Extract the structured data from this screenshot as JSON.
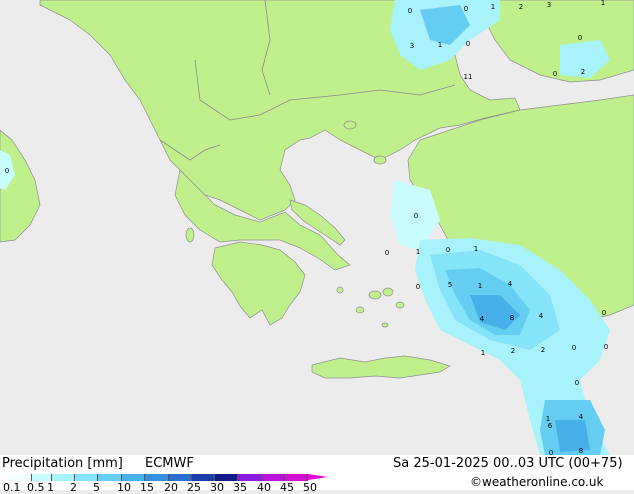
{
  "title": "Precipitation [mm]",
  "model": "ECMWF",
  "valid_time": "Sa 25-01-2025 00..03 UTC (00+75)",
  "copyright": "©weatheronline.co.uk",
  "legend": {
    "ticks": [
      "0.1",
      "0.5",
      "1",
      "2",
      "5",
      "10",
      "15",
      "20",
      "25",
      "30",
      "35",
      "40",
      "45",
      "50"
    ],
    "colors": [
      "#f0fffe",
      "#c8fcff",
      "#a8f2fb",
      "#86e4f8",
      "#64cdf1",
      "#47b0e8",
      "#3690dc",
      "#2a6fd0",
      "#1a3ea6",
      "#101a88",
      "#8a1ae0",
      "#b614d8",
      "#d40fd0",
      "#e80ad8"
    ]
  },
  "colors": {
    "land": "#c0f08c",
    "sea": "#ececec",
    "border": "#999999",
    "coast": "#909090"
  },
  "map_values": [
    "0",
    "0",
    "1",
    "2",
    "3",
    "1",
    "0",
    "3",
    "1",
    "0",
    "11",
    "0",
    "2",
    "0",
    "0",
    "0",
    "1",
    "0",
    "1",
    "0",
    "5",
    "1",
    "4",
    "4",
    "8",
    "4",
    "0",
    "1",
    "2",
    "2",
    "0",
    "0",
    "0",
    "0",
    "1",
    "4",
    "6",
    "8"
  ]
}
